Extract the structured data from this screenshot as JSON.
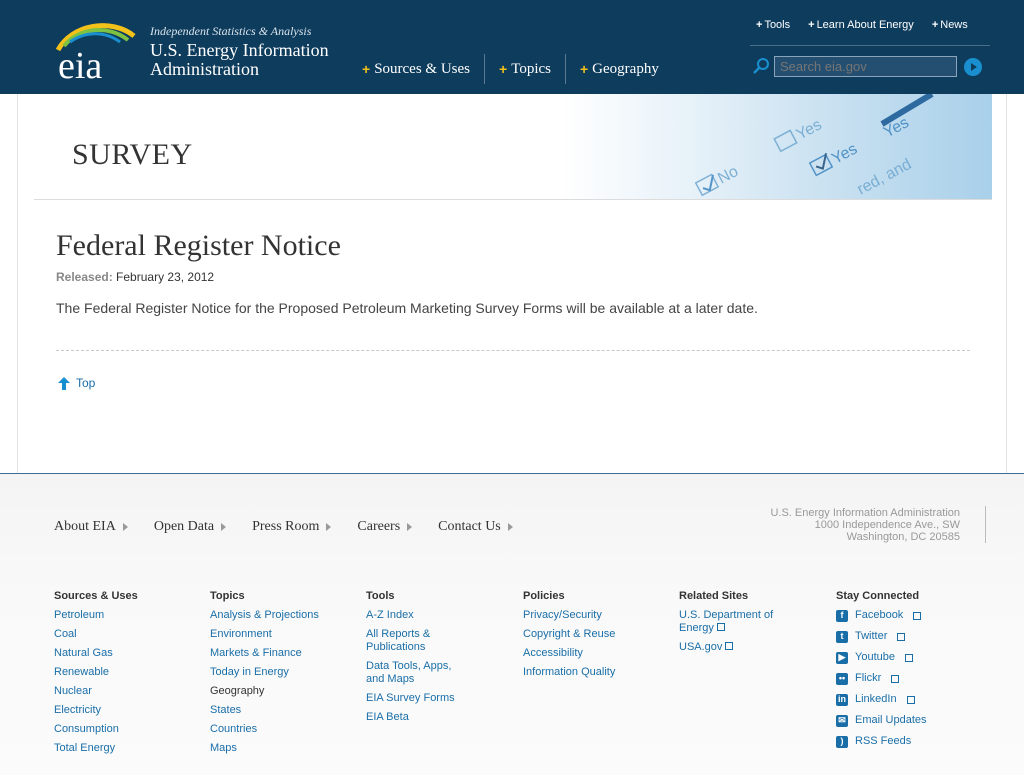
{
  "header": {
    "tagline": "Independent Statistics & Analysis",
    "agency_line1": "U.S. Energy Information",
    "agency_line2": "Administration",
    "logo_text": "eia",
    "main_nav": [
      "Sources & Uses",
      "Topics",
      "Geography"
    ],
    "util_nav": [
      "Tools",
      "Learn About Energy",
      "News"
    ],
    "search_placeholder": "Search eia.gov",
    "colors": {
      "bar": "#0e3c5d",
      "plus": "#f2c11a"
    }
  },
  "banner": {
    "section_title": "SURVEY",
    "art_words": [
      "No",
      "Yes",
      "No",
      "Yes",
      "No",
      "No",
      "Yes",
      "red, and"
    ]
  },
  "content": {
    "title": "Federal Register Notice",
    "released_label": "Released:",
    "released_date": "February 23, 2012",
    "body": "The Federal Register Notice for the Proposed Petroleum Marketing Survey Forms will be available at a later date.",
    "top_link": "Top"
  },
  "footer": {
    "nav": [
      "About EIA",
      "Open Data",
      "Press Room",
      "Careers",
      "Contact Us"
    ],
    "address": [
      "U.S. Energy Information Administration",
      "1000 Independence Ave., SW",
      "Washington, DC 20585"
    ],
    "columns": {
      "sources": {
        "heading": "Sources & Uses",
        "links": [
          "Petroleum",
          "Coal",
          "Natural Gas",
          "Renewable",
          "Nuclear",
          "Electricity",
          "Consumption",
          "Total Energy"
        ]
      },
      "topics": {
        "heading": "Topics",
        "links": [
          "Analysis & Projections",
          "Environment",
          "Markets & Finance",
          "Today in Energy"
        ],
        "subheading": "Geography",
        "sublinks": [
          "States",
          "Countries",
          "Maps"
        ]
      },
      "tools": {
        "heading": "Tools",
        "links": [
          "A-Z Index",
          "All Reports & Publications",
          "Data Tools, Apps, and Maps",
          "EIA Survey Forms",
          "EIA Beta"
        ]
      },
      "policies": {
        "heading": "Policies",
        "links": [
          "Privacy/Security",
          "Copyright & Reuse",
          "Accessibility",
          "Information Quality"
        ]
      },
      "related": {
        "heading": "Related Sites",
        "links": [
          "U.S. Department of Energy",
          "USA.gov"
        ]
      },
      "social": {
        "heading": "Stay Connected",
        "links": [
          "Facebook",
          "Twitter",
          "Youtube",
          "Flickr",
          "LinkedIn",
          "Email Updates",
          "RSS Feeds"
        ]
      }
    }
  }
}
